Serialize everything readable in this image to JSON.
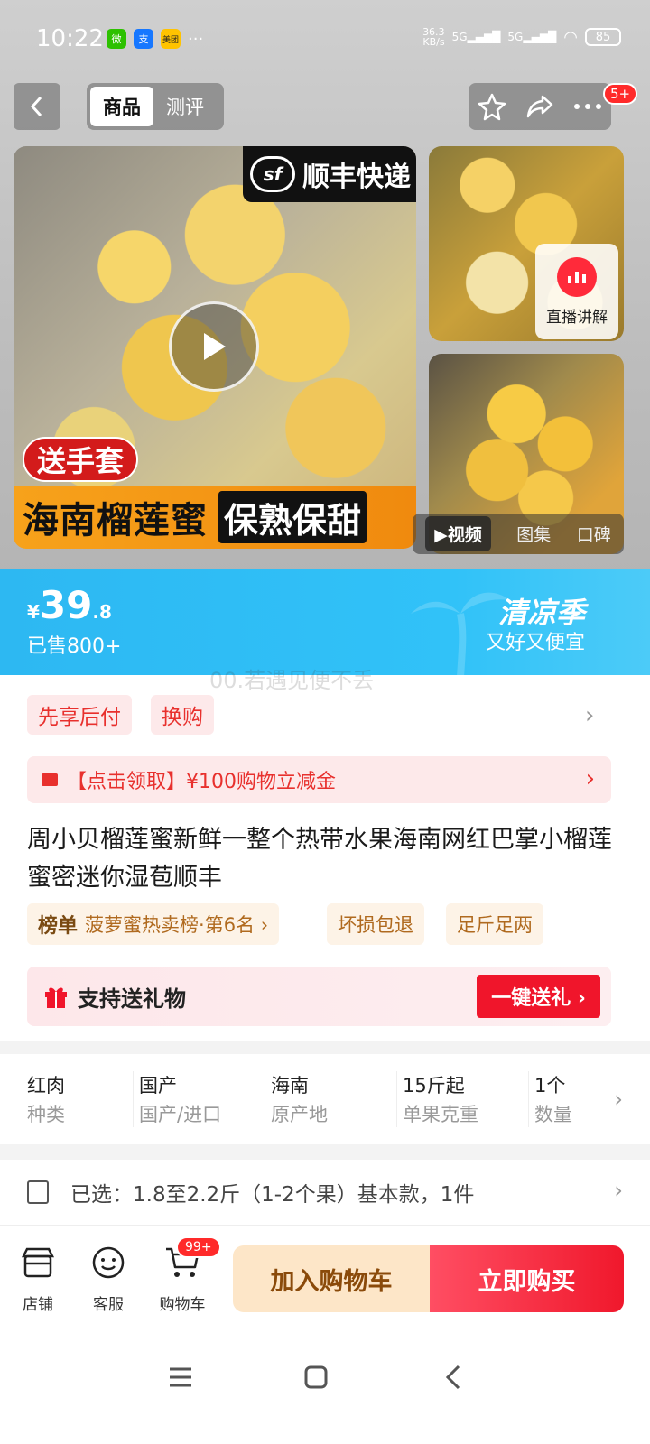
{
  "status": {
    "time": "10:22",
    "apps": [
      "微",
      "支",
      "美团"
    ],
    "more": "···",
    "netspeed_top": "36.3",
    "netspeed_bottom": "KB/s",
    "sig1": "5G",
    "sig2": "5G",
    "battery": "85"
  },
  "nav": {
    "tabs": [
      {
        "label": "商品"
      },
      {
        "label": "测评"
      }
    ],
    "notification_badge": "5+"
  },
  "media": {
    "sf_label": "顺丰快递",
    "sf_logo": "sf",
    "gift_tag": "送手套",
    "banner_left": "海南榴莲蜜",
    "banner_right": "保熟保甜",
    "live_label": "直播讲解",
    "tabs": [
      {
        "label": "▶视频"
      },
      {
        "label": "图集"
      },
      {
        "label": "口碑"
      }
    ]
  },
  "price": {
    "currency": "¥",
    "integer": "39",
    "decimal": ".8",
    "sold": "已售800+",
    "season_title": "清凉季",
    "season_sub": "又好又便宜"
  },
  "watermark": "00.若遇见便不丢",
  "chips": [
    {
      "label": "先享后付"
    },
    {
      "label": "换购"
    }
  ],
  "coupon": "【点击领取】¥100购物立减金",
  "product_title": "周小贝榴莲蜜新鲜一整个热带水果海南网红巴掌小榴莲蜜密迷你湿苞顺丰",
  "tags": {
    "rank_prefix": "榜单",
    "rank_text": "菠萝蜜热卖榜·第6名 ›",
    "t2": "坏损包退",
    "t3": "足斤足两"
  },
  "gift": {
    "text": "支持送礼物",
    "button": "一键送礼 ›"
  },
  "specs": [
    {
      "value": "红肉",
      "key": "种类"
    },
    {
      "value": "国产",
      "key": "国产/进口"
    },
    {
      "value": "海南",
      "key": "原产地"
    },
    {
      "value": "15斤起",
      "key": "单果克重"
    },
    {
      "value": "1个",
      "key": "数量"
    }
  ],
  "selected": "已选：1.8至2.2斤（1-2个果）基本款，1件",
  "bottom": {
    "shop": "店铺",
    "service": "客服",
    "cart": "购物车",
    "cart_badge": "99+",
    "add_cart": "加入购物车",
    "buy_now": "立即购买"
  },
  "colors": {
    "accent_red": "#f0152b",
    "price_blue": "#31c2f8",
    "tag_orange": "#b06a1f"
  }
}
